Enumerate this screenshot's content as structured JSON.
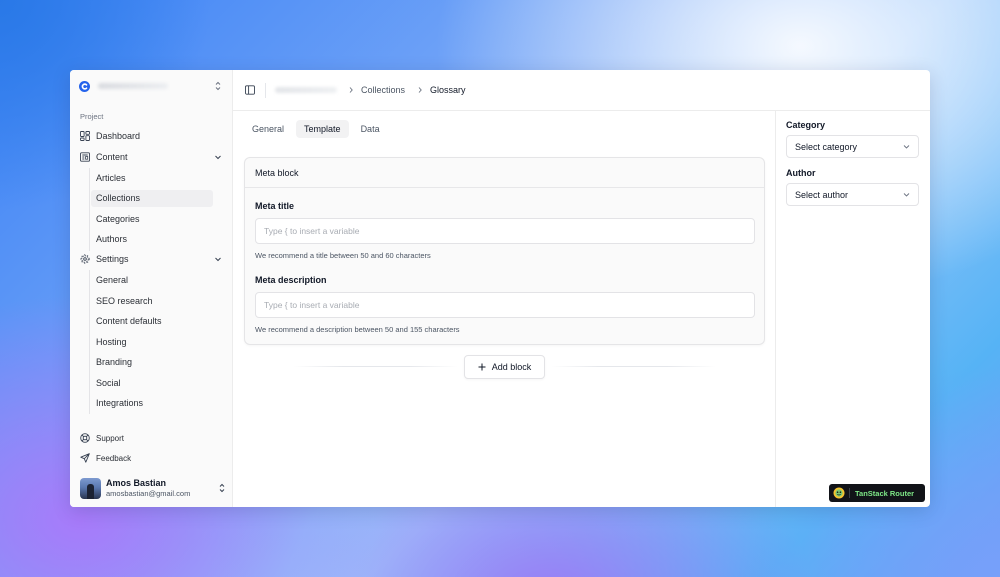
{
  "sidebar": {
    "group_label": "Project",
    "nav": {
      "dashboard": "Dashboard",
      "content": "Content",
      "settings": "Settings"
    },
    "content_items": [
      "Articles",
      "Collections",
      "Categories",
      "Authors"
    ],
    "settings_items": [
      "General",
      "SEO research",
      "Content defaults",
      "Hosting",
      "Branding",
      "Social",
      "Integrations"
    ],
    "active_item": "Collections",
    "footer": {
      "support": "Support",
      "feedback": "Feedback"
    },
    "user": {
      "name": "Amos Bastian",
      "email": "amosbastian@gmail.com"
    }
  },
  "header": {
    "breadcrumb": [
      "Collections",
      "Glossary"
    ]
  },
  "tabs": [
    "General",
    "Template",
    "Data"
  ],
  "active_tab": "Template",
  "meta_block": {
    "title": "Meta block",
    "meta_title": {
      "label": "Meta title",
      "placeholder": "Type { to insert a variable",
      "hint": "We recommend a title between 50 and 60 characters"
    },
    "meta_description": {
      "label": "Meta description",
      "placeholder": "Type { to insert a variable",
      "hint": "We recommend a description between 50 and 155 characters"
    }
  },
  "add_block_label": "Add block",
  "right_panel": {
    "category": {
      "label": "Category",
      "value": "Select category"
    },
    "author": {
      "label": "Author",
      "value": "Select author"
    }
  },
  "devtools_badge": "TanStack Router",
  "colors": {
    "accent": "#2563eb",
    "badge_text": "#7ee787"
  }
}
